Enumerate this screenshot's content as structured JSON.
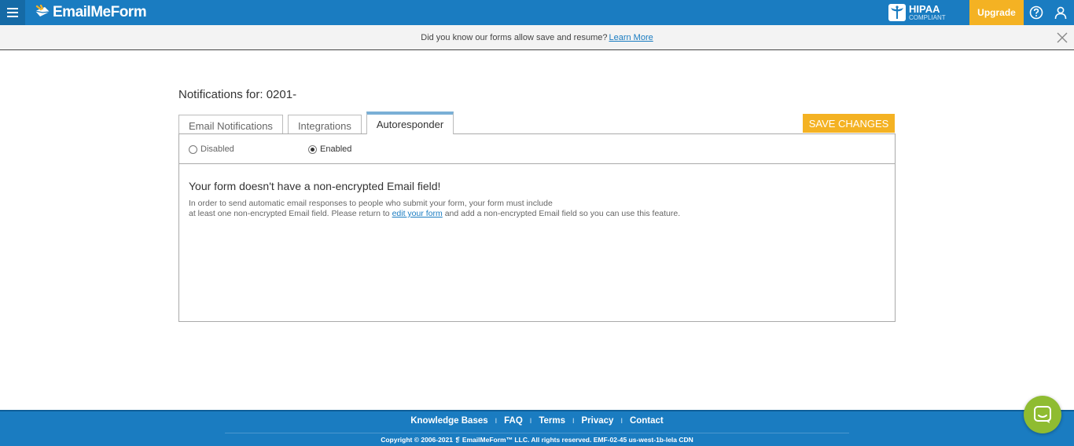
{
  "header": {
    "logo_text": "EmailMeForm",
    "hipaa_title": "HIPAA",
    "hipaa_sub": "COMPLIANT",
    "upgrade_label": "Upgrade"
  },
  "banner": {
    "text": "Did you know our forms allow save and resume?",
    "link": "Learn More"
  },
  "page": {
    "title": "Notifications for: 0201-",
    "save_label": "SAVE CHANGES",
    "tabs": [
      {
        "label": "Email Notifications",
        "active": false
      },
      {
        "label": "Integrations",
        "active": false
      },
      {
        "label": "Autoresponder",
        "active": true
      }
    ],
    "radios": {
      "disabled_label": "Disabled",
      "enabled_label": "Enabled",
      "selected": "Enabled"
    },
    "message": {
      "title": "Your form doesn't have a non-encrypted Email field!",
      "line1": "In order to send automatic email responses to people who submit your form, your form must include",
      "line2_pre": "at least one non-encrypted Email field. Please return to",
      "line2_link": "edit your form",
      "line2_post": "and add a non-encrypted Email field so you can use this feature."
    }
  },
  "footer": {
    "links": [
      "Knowledge Bases",
      "FAQ",
      "Terms",
      "Privacy",
      "Contact"
    ],
    "separator": "I",
    "copyright": "Copyright © 2006-2021 ❡ EmailMeForm™ LLC. All rights reserved. EMF-02-45 us-west-1b-lela CDN"
  },
  "colors": {
    "brand_blue": "#1a7cc1",
    "accent_orange": "#f4b223",
    "chat_green": "#8fbc31"
  },
  "icons": [
    "menu-icon",
    "logo-envelope-icon",
    "hipaa-caduceus-icon",
    "help-icon",
    "user-icon",
    "close-icon",
    "chat-icon"
  ]
}
